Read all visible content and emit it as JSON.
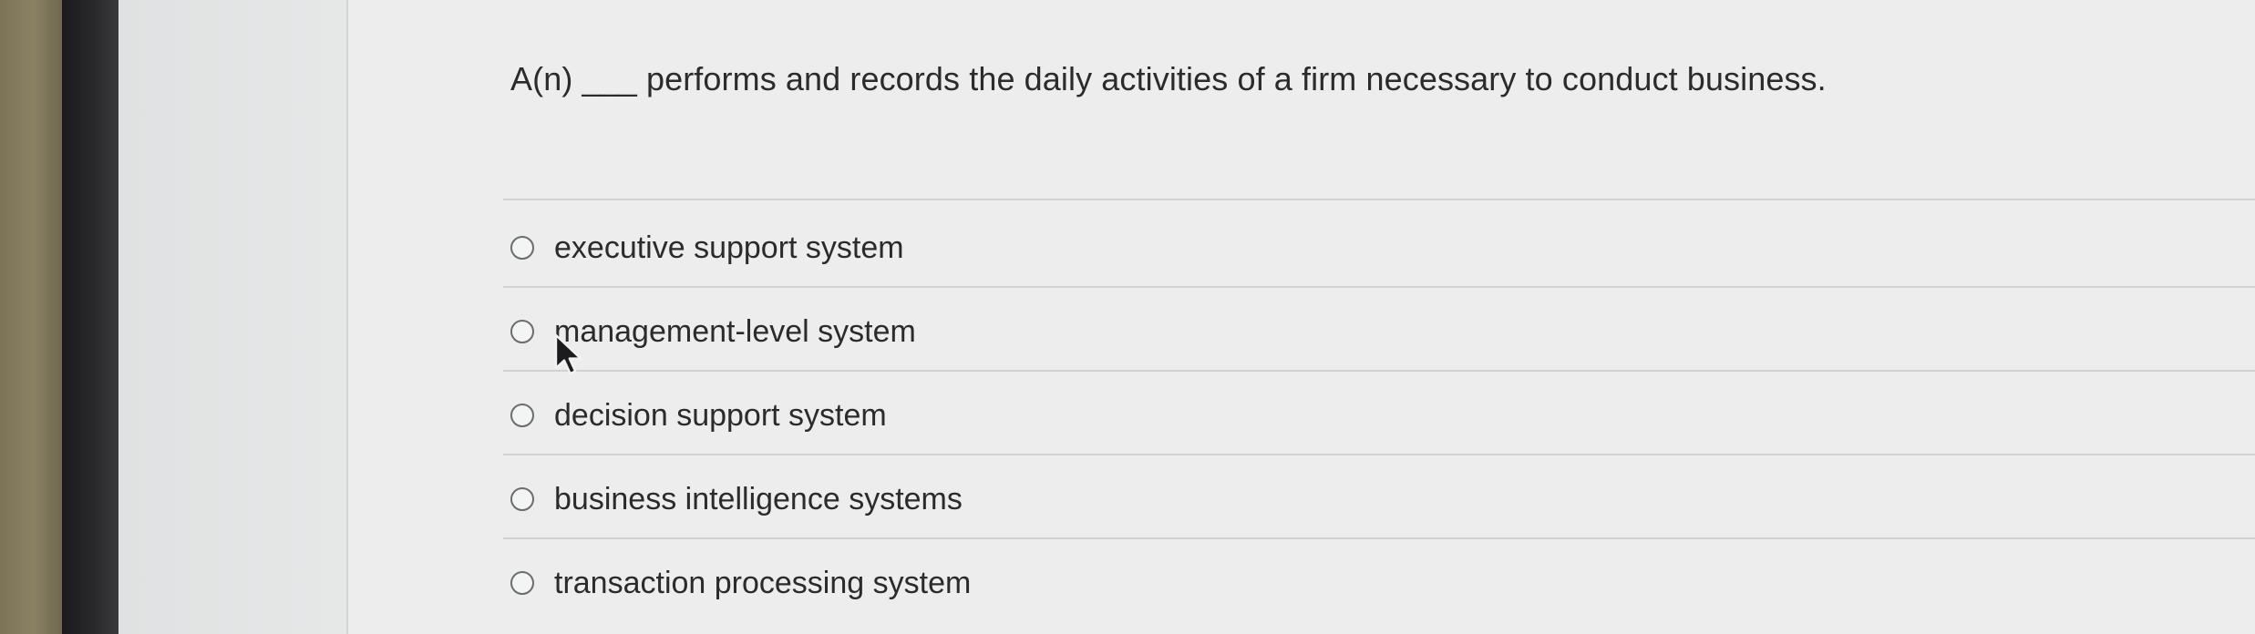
{
  "question": {
    "text": "A(n) ___ performs and records the daily activities of a firm necessary to conduct business."
  },
  "options": [
    {
      "label": "executive support system",
      "selected": false
    },
    {
      "label": "management-level system",
      "selected": false
    },
    {
      "label": "decision support system",
      "selected": false
    },
    {
      "label": "business intelligence systems",
      "selected": false
    },
    {
      "label": "transaction processing system",
      "selected": false
    }
  ],
  "icons": {
    "cursor": "mouse-pointer-icon",
    "radio": "radio-button-icon"
  },
  "colors": {
    "text": "#2b2b2c",
    "background": "#ecedec",
    "bezel": "#1b1b1d",
    "radio_border": "#6a6c6e"
  }
}
